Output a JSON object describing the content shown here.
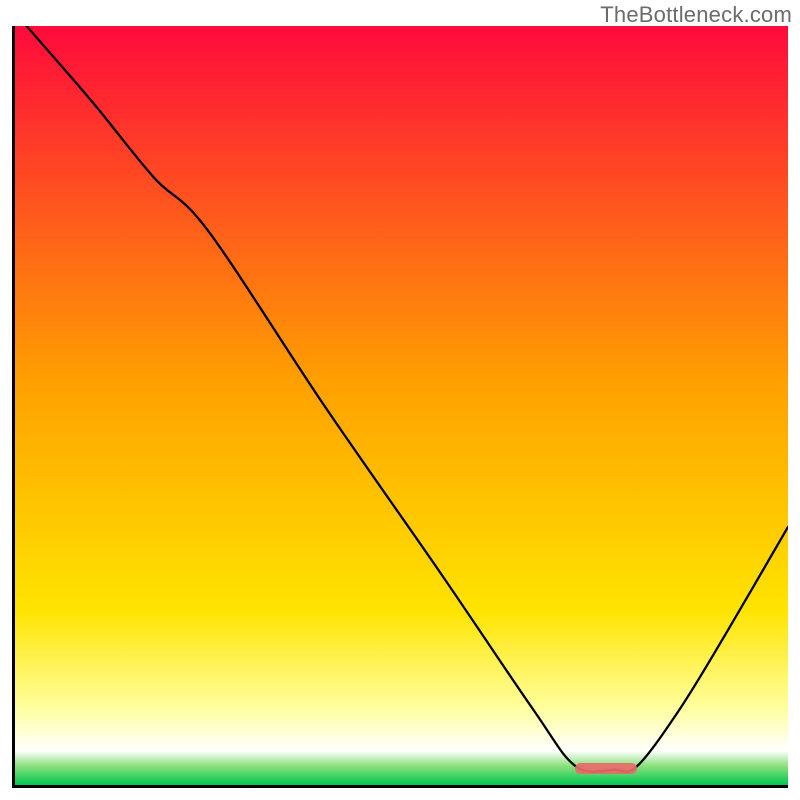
{
  "watermark": "TheBottleneck.com",
  "chart_data": {
    "type": "line",
    "title": "",
    "xlabel": "",
    "ylabel": "",
    "xlim": [
      0,
      100
    ],
    "ylim": [
      0,
      100
    ],
    "grid": false,
    "gradient_stops": [
      {
        "offset": 0,
        "color": "#ff0a3c"
      },
      {
        "offset": 0.47,
        "color": "#ffa000"
      },
      {
        "offset": 0.77,
        "color": "#ffe400"
      },
      {
        "offset": 0.9,
        "color": "#ffffa0"
      },
      {
        "offset": 0.955,
        "color": "#ffffff"
      },
      {
        "offset": 0.975,
        "color": "#8ae07a"
      },
      {
        "offset": 1.0,
        "color": "#00c853"
      }
    ],
    "series": [
      {
        "name": "bottleneck-curve",
        "x": [
          1.5,
          10,
          18,
          25,
          40,
          55,
          67,
          72.5,
          77.5,
          80.5,
          86,
          92,
          100
        ],
        "y": [
          100,
          90,
          80,
          73,
          50,
          28,
          10,
          2.5,
          2,
          2.5,
          10,
          20,
          34
        ]
      }
    ],
    "marker": {
      "name": "optimal-range",
      "x_start": 72.5,
      "x_end": 80.5,
      "y": 2.2,
      "color": "#e86a6a",
      "height_pct": 1.4
    }
  }
}
